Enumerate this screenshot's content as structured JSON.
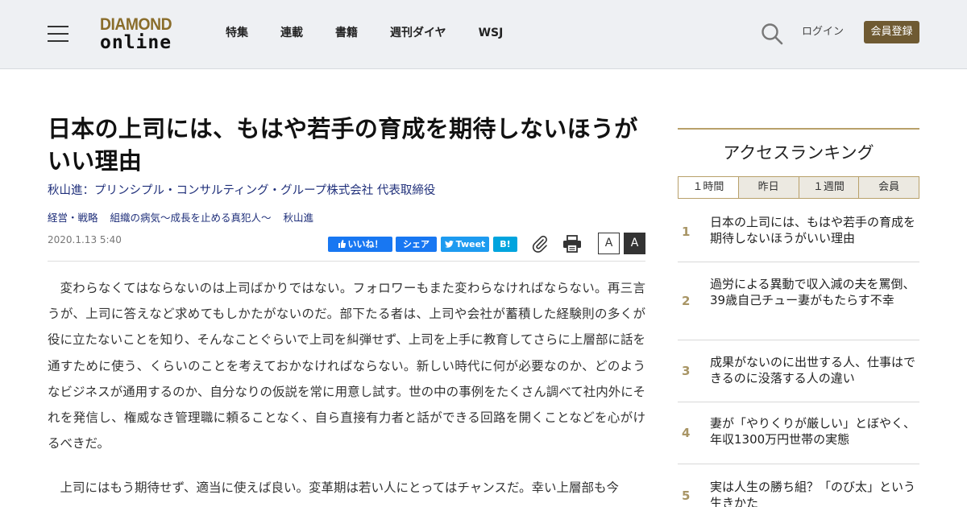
{
  "header": {
    "logo_top": "DIAMOND",
    "logo_bottom": "online",
    "nav": [
      "特集",
      "連載",
      "書籍",
      "週刊ダイヤ",
      "WSJ"
    ],
    "login": "ログイン",
    "register": "会員登録"
  },
  "article": {
    "title": "日本の上司には、もはや若手の育成を期待しないほうがいい理由",
    "byline": "秋山進：プリンシプル・コンサルティング・グループ株式会社 代表取締役",
    "tags": [
      "経営・戦略",
      "組織の病気～成長を止める真犯人～",
      "秋山進"
    ],
    "date": "2020.1.13 5:40",
    "share": {
      "like": "いいね！",
      "facebook": "シェア",
      "tweet": "Tweet",
      "hatena": "B!"
    },
    "font_small": "A",
    "font_large": "A",
    "paragraphs": [
      "変わらなくてはならないのは上司ばかりではない。フォロワーもまた変わらなければならない。再三言うが、上司に答えなど求めてもしかたがないのだ。部下たる者は、上司や会社が蓄積した経験則の多くが役に立たないことを知り、そんなことぐらいで上司を糾弾せず、上司を上手に教育してさらに上層部に話を通すために使う、くらいのことを考えておかなければならない。新しい時代に何が必要なのか、どのようなビジネスが通用するのか、自分なりの仮説を常に用意し試す。世の中の事例をたくさん調べて社内外にそれを発信し、権威なき管理職に頼ることなく、自ら直接有力者と話ができる回路を開くことなどを心がけるべきだ。",
      "上司にはもう期待せず、適当に使えば良い。変革期は若い人にとってはチャンスだ。幸い上層部も今"
    ]
  },
  "sidebar": {
    "title": "アクセスランキング",
    "tabs": [
      "１時間",
      "昨日",
      "１週間",
      "会員"
    ],
    "ranking": [
      {
        "rank": "1",
        "text": "日本の上司には、もはや若手の育成を期待しないほうがいい理由"
      },
      {
        "rank": "2",
        "text": "過労による異動で収入減の夫を罵倒、39歳自己チュー妻がもたらす不幸"
      },
      {
        "rank": "3",
        "text": "成果がないのに出世する人、仕事はできるのに没落する人の違い"
      },
      {
        "rank": "4",
        "text": "妻が「やりくりが厳しい」とぼやく、年収1300万円世帯の実態"
      },
      {
        "rank": "5",
        "text": "実は人生の勝ち組？「のび太」という生きかた"
      }
    ]
  },
  "colors": {
    "accent": "#6f5a32",
    "rank_number": "#a89565",
    "link": "#1f2f7a"
  }
}
